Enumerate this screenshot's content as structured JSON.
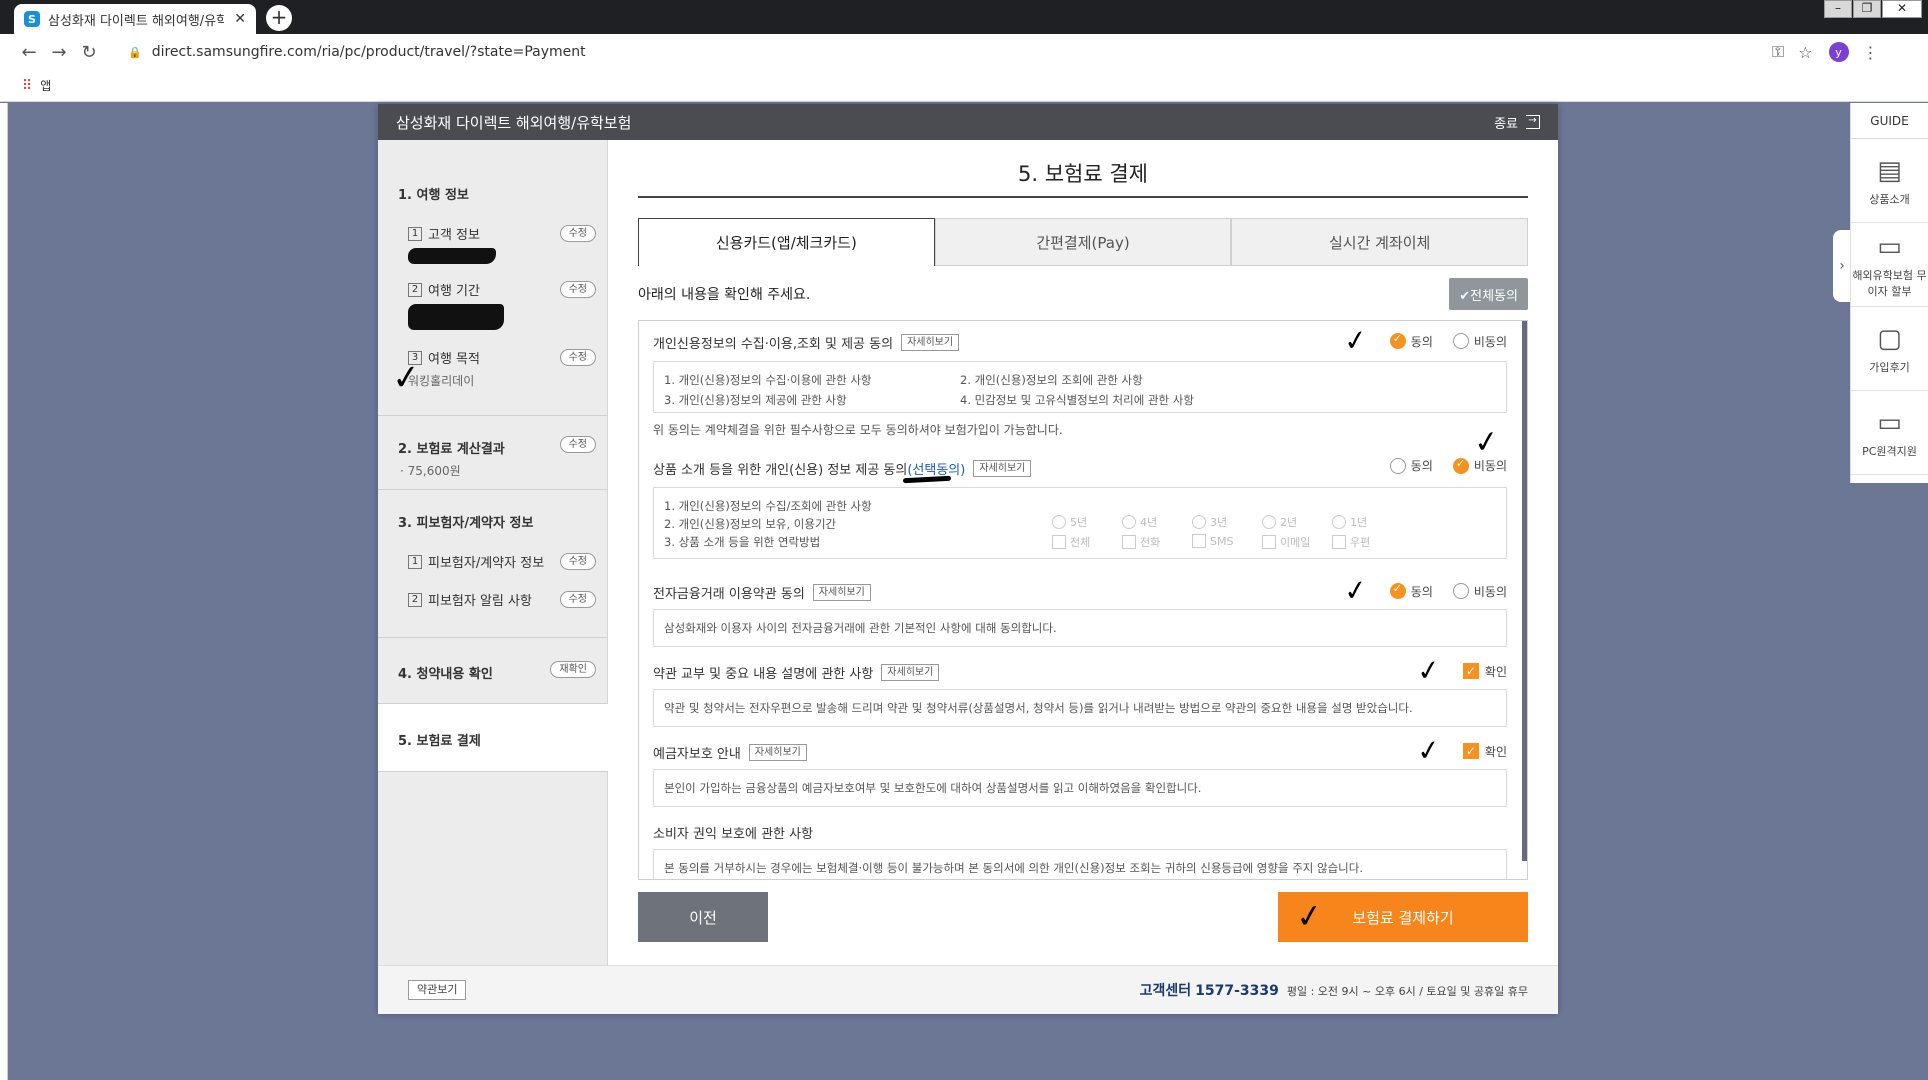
{
  "browser": {
    "tab_title": "삼성화재 다이렉트 해외여행/유학보험",
    "favicon_text": "S",
    "new_tab": "+",
    "url": "direct.samsungfire.com/ria/pc/product/travel/?state=Payment",
    "bookmarks_apps_label": "앱",
    "avatar_letter": "y"
  },
  "header": {
    "title": "삼성화재 다이렉트 해외여행/유학보험",
    "exit_label": "종료"
  },
  "sidebar": {
    "s1_title": "1. 여행 정보",
    "s1_items": [
      {
        "num": "1",
        "label": "고객 정보",
        "button": "수정"
      },
      {
        "num": "2",
        "label": "여행 기간",
        "button": "수정"
      },
      {
        "num": "3",
        "label": "여행 목적",
        "button": "수정",
        "value": "워킹홀리데이"
      }
    ],
    "s2_title": "2. 보험료 계산결과",
    "s2_button": "수정",
    "s2_value": "· 75,600원",
    "s3_title": "3. 피보험자/계약자 정보",
    "s3_items": [
      {
        "num": "1",
        "label": "피보험자/계약자 정보",
        "button": "수정"
      },
      {
        "num": "2",
        "label": "피보험자 알림 사항",
        "button": "수정"
      }
    ],
    "s4_title": "4. 청약내용 확인",
    "s4_button": "재확인",
    "s5_title": "5. 보험료 결제"
  },
  "main": {
    "title": "5. 보험료 결제",
    "tabs": [
      "신용카드(앱/체크카드)",
      "간편결제(Pay)",
      "실시간 계좌이체"
    ],
    "instruction": "아래의 내용을 확인해 주세요.",
    "all_agree": "✔전체동의",
    "detail_label": "자세히보기",
    "agree": "동의",
    "disagree": "비동의",
    "confirm": "확인",
    "b1": {
      "title": "개인신용정보의 수집·이용,조회 및 제공 동의",
      "items": [
        "1. 개인(신용)정보의 수집·이용에 관한 사항",
        "2. 개인(신용)정보의 조회에 관한 사항",
        "3. 개인(신용)정보의 제공에 관한 사항",
        "4. 민감정보 및 고유식별정보의 처리에 관한 사항"
      ],
      "note": "위 동의는 계약체결을 위한 필수사항으로 모두 동의하셔야 보험가입이 가능합니다."
    },
    "b2": {
      "title": "상품 소개 등을 위한 개인(신용) 정보 제공 동의",
      "optional": "(선택동의)",
      "items": [
        "1. 개인(신용)정보의 수집/조회에 관한 사항",
        "2. 개인(신용)정보의 보유, 이용기간",
        "3. 상품 소개 등을 위한 연락방법"
      ],
      "periods": [
        "5년",
        "4년",
        "3년",
        "2년",
        "1년"
      ],
      "methods": [
        "전체",
        "전화",
        "SMS",
        "이메일",
        "우편"
      ]
    },
    "b3": {
      "title": "전자금융거래 이용약관 동의",
      "text": "삼성화재와 이용자 사이의 전자금융거래에 관한 기본적인 사항에 대해 동의합니다."
    },
    "b4": {
      "title": "약관 교부 및 중요 내용 설명에 관한 사항",
      "text": "약관 및 청약서는 전자우편으로 발송해 드리며 약관 및 청약서류(상품설명서, 청약서 등)를 읽거나 내려받는 방법으로 약관의 중요한 내용을 설명 받았습니다."
    },
    "b5": {
      "title": "예금자보호 안내",
      "text": "본인이 가입하는 금융상품의 예금자보호여부 및 보호한도에 대하여 상품설명서를 읽고 이해하였음을 확인합니다."
    },
    "b6": {
      "title": "소비자 권익 보호에 관한 사항",
      "text": "본 동의를 거부하시는 경우에는 보험체결·이행 등이 불가능하며 본 동의서에 의한 개인(신용)정보 조회는 귀하의 신용등급에 영향을 주지 않습니다."
    },
    "prev_button": "이전",
    "pay_button": "보험료 결제하기"
  },
  "footer": {
    "terms_button": "약관보기",
    "cs_label": "고객센터",
    "cs_number": "1577-3339",
    "cs_hours": "평일 : 오전 9시 ~ 오후 6시 / 토요일 및 공휴일 휴무"
  },
  "guide": {
    "title": "GUIDE",
    "items": [
      "상품소개",
      "해외유학보험 무이자 할부",
      "가입후기",
      "PC원격지원"
    ]
  },
  "colors": {
    "accent": "#f7851b",
    "header": "#4a4c52",
    "backdrop": "#6c7796"
  }
}
